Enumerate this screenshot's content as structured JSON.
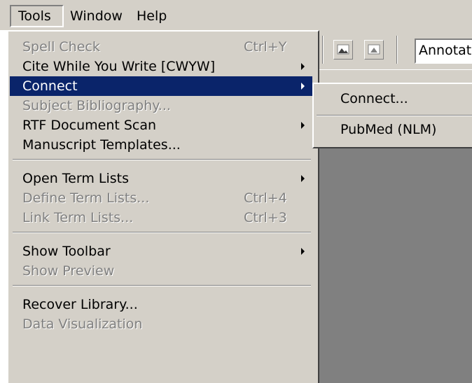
{
  "menubar": {
    "items": [
      {
        "label": "Tools"
      },
      {
        "label": "Window"
      },
      {
        "label": "Help"
      }
    ]
  },
  "toolbar": {
    "combo_value": "Annotat"
  },
  "tools_menu": {
    "items": [
      {
        "label": "Spell Check",
        "shortcut": "Ctrl+Y"
      },
      {
        "label": "Cite While You Write [CWYW]"
      },
      {
        "label": "Connect"
      },
      {
        "label": "Subject Bibliography..."
      },
      {
        "label": "RTF Document Scan"
      },
      {
        "label": "Manuscript Templates..."
      },
      {
        "label": "Open Term Lists"
      },
      {
        "label": "Define Term Lists...",
        "shortcut": "Ctrl+4"
      },
      {
        "label": "Link Term Lists...",
        "shortcut": "Ctrl+3"
      },
      {
        "label": "Show Toolbar"
      },
      {
        "label": "Show Preview"
      },
      {
        "label": "Recover Library..."
      },
      {
        "label": "Data Visualization"
      }
    ]
  },
  "connect_submenu": {
    "items": [
      {
        "label": "Connect..."
      },
      {
        "label": "PubMed (NLM)"
      }
    ]
  },
  "colors": {
    "menu_face": "#d4d0c8",
    "highlight": "#0a246a",
    "disabled_text": "#808080"
  }
}
